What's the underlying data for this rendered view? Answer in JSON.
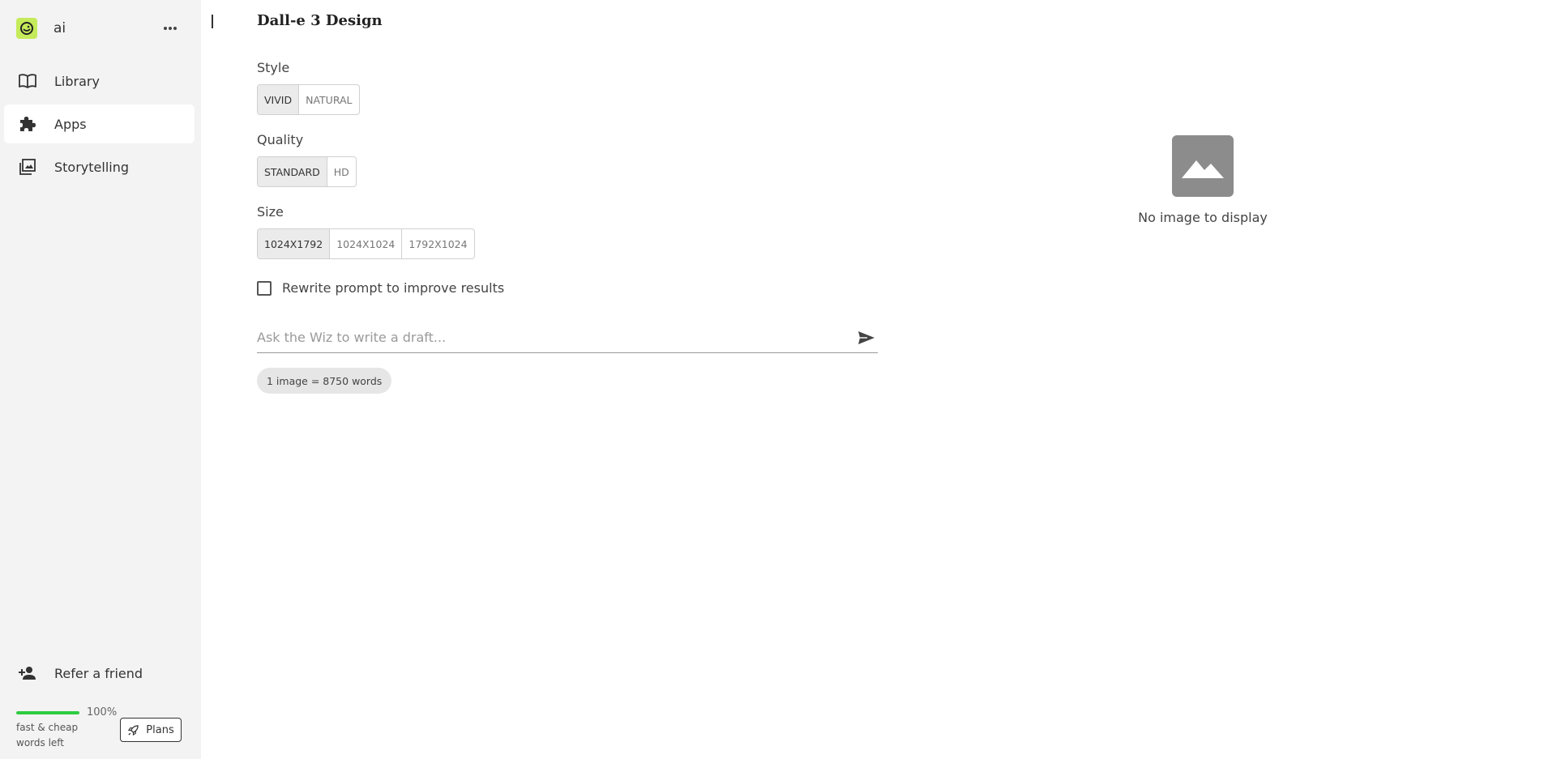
{
  "workspace": {
    "name": "ai"
  },
  "sidebar": {
    "items": [
      {
        "label": "Library",
        "icon": "book-open-icon"
      },
      {
        "label": "Apps",
        "icon": "puzzle-icon",
        "active": true
      },
      {
        "label": "Storytelling",
        "icon": "storytelling-icon"
      }
    ],
    "refer_label": "Refer a friend",
    "usage": {
      "percent": 100,
      "percent_label": "100%",
      "text": "fast & cheap words left",
      "bar_color": "#2ecc40"
    },
    "plans_label": "Plans"
  },
  "main": {
    "title": "Dall-e 3 Design",
    "style": {
      "label": "Style",
      "options": [
        "VIVID",
        "NATURAL"
      ],
      "selected": "VIVID"
    },
    "quality": {
      "label": "Quality",
      "options": [
        "STANDARD",
        "HD"
      ],
      "selected": "STANDARD"
    },
    "size": {
      "label": "Size",
      "options": [
        "1024X1792",
        "1024X1024",
        "1792X1024"
      ],
      "selected": "1024X1792"
    },
    "rewrite": {
      "label": "Rewrite prompt to improve results",
      "checked": false
    },
    "prompt": {
      "placeholder": "Ask the Wiz to write a draft...",
      "value": ""
    },
    "cost_pill": "1 image = 8750 words",
    "preview": {
      "empty_text": "No image to display"
    }
  },
  "colors": {
    "sidebar_bg": "#f3f3f3",
    "logo_accent": "#c5ea5a",
    "selected_segment": "#ebebeb"
  }
}
